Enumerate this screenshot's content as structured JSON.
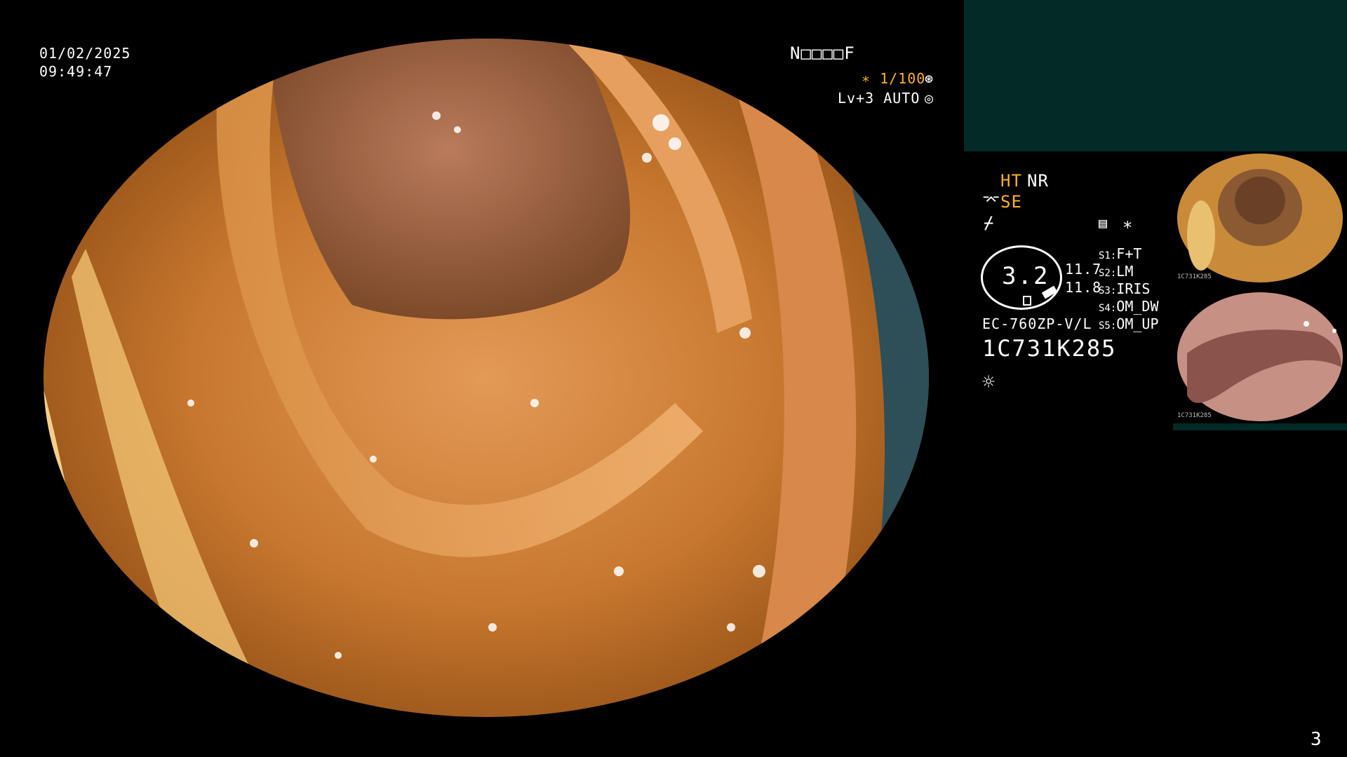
{
  "overlay": {
    "date": "01/02/2025",
    "time": "09:49:47",
    "patient_code": "N□□□□F",
    "shutter": "∗ 1/100",
    "level": "Lv+3 AUTO",
    "page_number": "3"
  },
  "settings": {
    "ht": "HT",
    "nr": "NR",
    "se": "SE",
    "asterisk": "∗"
  },
  "scope": {
    "value": "3.2",
    "readout_1": "11.7",
    "readout_2": "11.8",
    "model": "EC-760ZP-V/L",
    "serial": "1C731K285"
  },
  "switches": [
    {
      "key": "S1:",
      "label": "F+T"
    },
    {
      "key": "S2:",
      "label": "LM"
    },
    {
      "key": "S3:",
      "label": "IRIS"
    },
    {
      "key": "S4:",
      "label": "OM_DW"
    },
    {
      "key": "S5:",
      "label": "OM_UP"
    }
  ],
  "thumbnails": [
    {
      "caption": "1C731K285"
    },
    {
      "caption": "1C731K285"
    }
  ],
  "colors": {
    "accent_orange": "#ffb31a",
    "panel_teal": "#032a26",
    "mucosa": "#c8782e"
  }
}
